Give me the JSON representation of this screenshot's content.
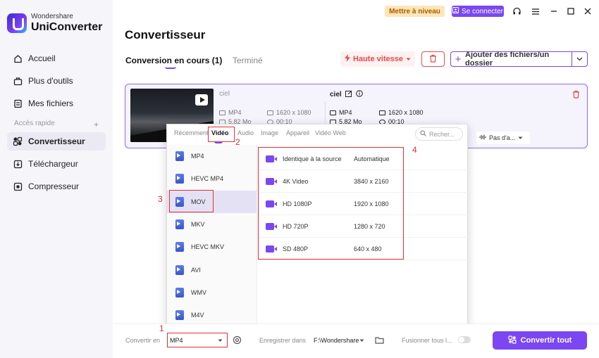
{
  "app": {
    "brand_small": "Wondershare",
    "brand_big": "UniConverter"
  },
  "titlebar": {
    "upgrade": "Mettre à niveau",
    "login": "Se connecter"
  },
  "sidebar": {
    "items": [
      {
        "label": "Accueil",
        "icon": "home-icon"
      },
      {
        "label": "Plus d'outils",
        "icon": "toolbox-icon"
      },
      {
        "label": "Mes fichiers",
        "icon": "files-icon"
      }
    ],
    "quick_access": "Accès rapide",
    "quick_items": [
      {
        "label": "Convertisseur",
        "icon": "converter-icon",
        "active": true
      },
      {
        "label": "Téléchargeur",
        "icon": "downloader-icon"
      },
      {
        "label": "Compresseur",
        "icon": "compressor-icon"
      }
    ]
  },
  "main": {
    "title": "Convertisseur",
    "tabs": {
      "active": "Conversion en cours (1)",
      "inactive": "Terminé"
    },
    "speed_label": "Haute vitesse",
    "add_label": "Ajouter des fichiers/un dossier"
  },
  "file": {
    "source": {
      "name": "ciel",
      "format": "MP4",
      "resolution": "1620 x 1080",
      "size": "5.82 Mo",
      "duration": "00:10"
    },
    "output": {
      "name": "ciel",
      "format": "MP4",
      "resolution": "1620 x 1080",
      "size": "5.82 Mo",
      "duration": "00:10"
    },
    "audio_label": "Pas d'a..."
  },
  "panel": {
    "tabs": [
      "Récemment",
      "Vidéo",
      "Audio",
      "Image",
      "Appareil",
      "Vidéo Web"
    ],
    "search_placeholder": "Recher...",
    "formats": [
      "MP4",
      "HEVC MP4",
      "MOV",
      "MKV",
      "HEVC MKV",
      "AVI",
      "WMV",
      "M4V"
    ],
    "selected_format": "MOV",
    "resolutions": [
      {
        "name": "Identique à la source",
        "value": "Automatique"
      },
      {
        "name": "4K Video",
        "value": "3840 x 2160"
      },
      {
        "name": "HD 1080P",
        "value": "1920 x 1080"
      },
      {
        "name": "HD 720P",
        "value": "1280 x 720"
      },
      {
        "name": "SD 480P",
        "value": "640 x 480"
      }
    ]
  },
  "annotations": {
    "n1": "1",
    "n2": "2",
    "n3": "3",
    "n4": "4"
  },
  "bottom": {
    "convert_in_label": "Convertir en",
    "convert_in_value": "MP4",
    "save_in_label": "Enregistrer dans",
    "save_in_value": "F:\\Wondershare",
    "merge_label": "Fusionner tous l...",
    "convert_all": "Convertir tout"
  },
  "colors": {
    "accent": "#7a47f2",
    "danger": "#e24b4b",
    "annotation": "#e0303a"
  }
}
